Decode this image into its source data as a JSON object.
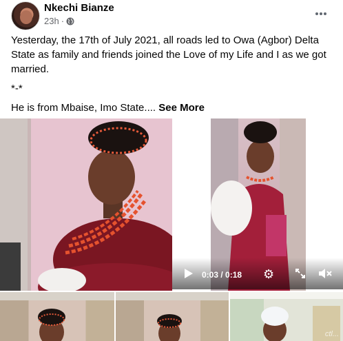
{
  "post": {
    "author": "Nkechi Bianze",
    "time": "23h",
    "paragraphs": [
      "Yesterday, the 17th of July 2021, all roads led to Owa (Agbor) Delta State as family and friends joined the Love of my Life and I as we got married.",
      "*-*",
      "He is from Mbaise, Imo State...."
    ],
    "see_more": "See More"
  },
  "video": {
    "time": "0:03 / 0:18"
  },
  "watermark": "ctl..."
}
